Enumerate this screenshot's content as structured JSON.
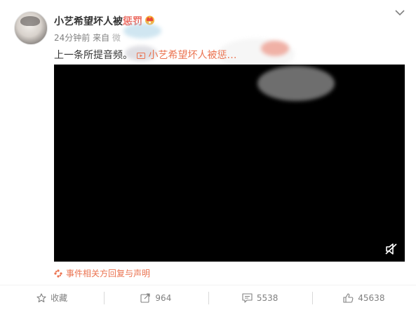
{
  "post": {
    "username": "小艺希望坏人被",
    "username_tail": "惩罚",
    "time": "24分钟前",
    "source_prefix": "来自",
    "source_fragment": "微",
    "text_prefix": "上一条所提音频。",
    "link_text": "小艺希望坏人被惩…",
    "statement": "事件相关方回复与声明"
  },
  "actions": {
    "favorite": "收藏",
    "repost": "964",
    "comment": "5538",
    "like": "45638"
  },
  "colors": {
    "link": "#eb7350",
    "video_bg": "#000000",
    "meta": "#808080"
  },
  "icons": {
    "chevron": "chevron-down-icon",
    "vip": "vip-crown-icon",
    "mute": "mute-icon",
    "statement": "statement-icon",
    "favorite": "star-icon",
    "repost": "repost-icon",
    "comment": "comment-icon",
    "like": "thumbs-up-icon"
  }
}
